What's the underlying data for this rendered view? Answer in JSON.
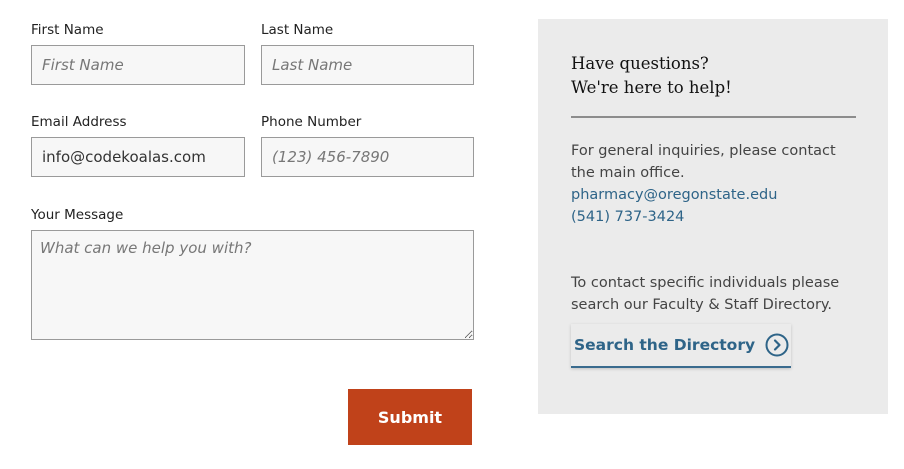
{
  "form": {
    "first_name": {
      "label": "First Name",
      "placeholder": "First Name",
      "value": ""
    },
    "last_name": {
      "label": "Last Name",
      "placeholder": "Last Name",
      "value": ""
    },
    "email": {
      "label": "Email Address",
      "placeholder": "",
      "value": "info@codekoalas.com"
    },
    "phone": {
      "label": "Phone Number",
      "placeholder": "(123) 456-7890",
      "value": ""
    },
    "message": {
      "label": "Your Message",
      "placeholder": "What can we help you with?",
      "value": ""
    },
    "submit_label": "Submit"
  },
  "sidebar": {
    "heading_line1": "Have questions?",
    "heading_line2": "We're here to help!",
    "general_text": "For general inquiries, please contact the main office.",
    "email_link": "pharmacy@oregonstate.edu",
    "phone_link": "(541) 737-3424",
    "directory_text": "To contact specific individuals please search our Faculty & Staff Directory.",
    "directory_button_label": "Search the Directory",
    "directory_button_icon": "chevron-right-circle-icon"
  },
  "colors": {
    "submit_bg": "#c0421a",
    "link": "#2e6488",
    "panel_bg": "#ebebeb"
  }
}
